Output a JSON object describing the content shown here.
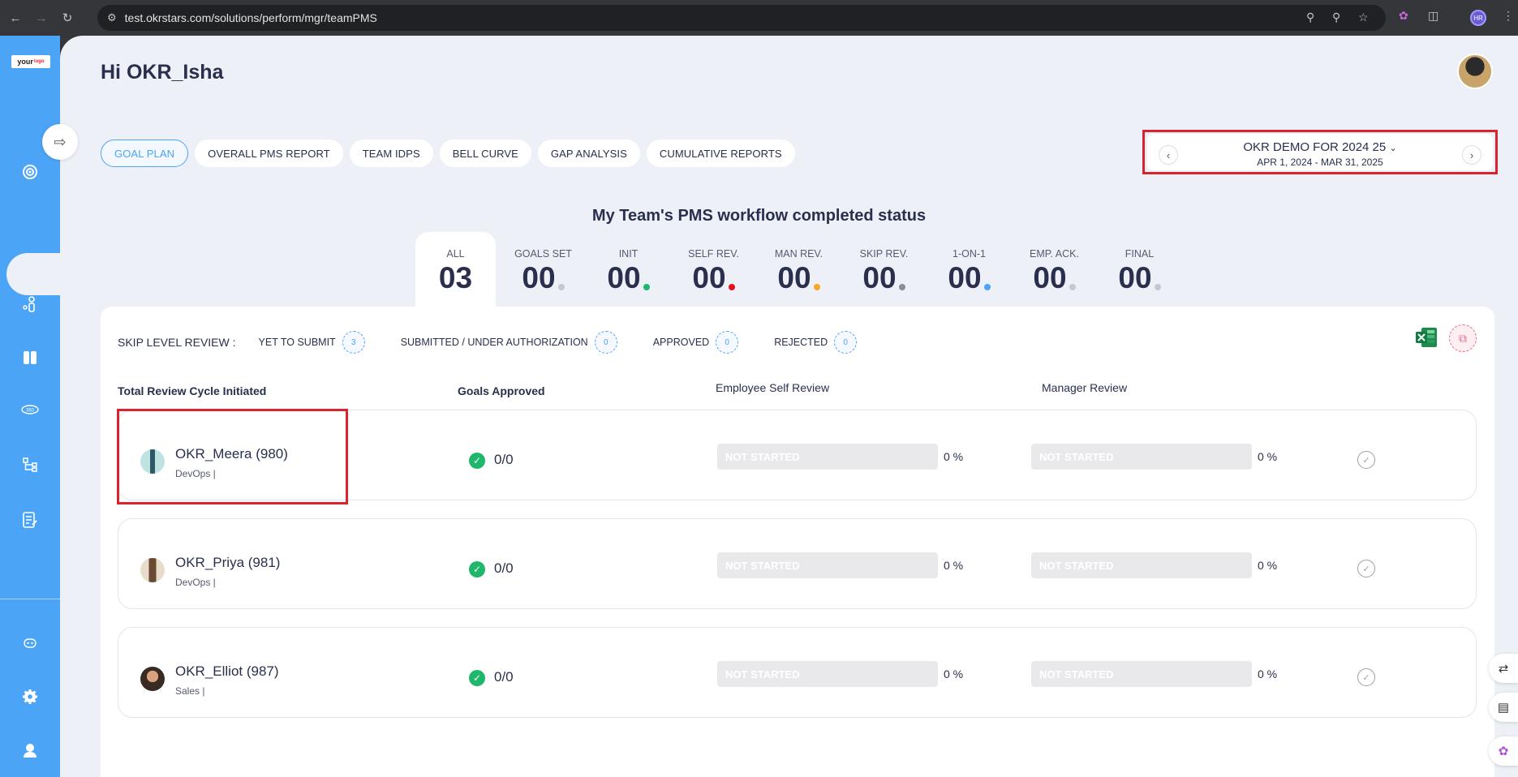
{
  "browser": {
    "url": "test.okrstars.com/solutions/perform/mgr/teamPMS",
    "profile_initials": "HR"
  },
  "brand": {
    "logo_text": "your",
    "logo_sup": "logo"
  },
  "greeting": "Hi OKR_Isha",
  "tabs": [
    {
      "label": "GOAL PLAN",
      "active": true
    },
    {
      "label": "OVERALL PMS REPORT"
    },
    {
      "label": "TEAM IDPS"
    },
    {
      "label": "BELL CURVE"
    },
    {
      "label": "GAP ANALYSIS"
    },
    {
      "label": "CUMULATIVE REPORTS"
    }
  ],
  "cycle": {
    "title": "OKR DEMO FOR 2024 25",
    "dates": "APR 1, 2024 - MAR 31, 2025"
  },
  "status_heading": "My Team's PMS workflow completed status",
  "stats": [
    {
      "label": "ALL",
      "value": "03",
      "dot": ""
    },
    {
      "label": "GOALS SET",
      "value": "00",
      "dot": "#c6c8cf"
    },
    {
      "label": "INIT",
      "value": "00",
      "dot": "#1fb76b"
    },
    {
      "label": "SELF REV.",
      "value": "00",
      "dot": "#e3141e"
    },
    {
      "label": "MAN REV.",
      "value": "00",
      "dot": "#f5a623"
    },
    {
      "label": "SKIP REV.",
      "value": "00",
      "dot": "#8a8d96"
    },
    {
      "label": "1-ON-1",
      "value": "00",
      "dot": "#4ba4f6"
    },
    {
      "label": "EMP. ACK.",
      "value": "00",
      "dot": "#c6c8cf"
    },
    {
      "label": "FINAL",
      "value": "00",
      "dot": "#c6c8cf"
    }
  ],
  "skip_review": {
    "title": "SKIP LEVEL REVIEW :",
    "items": [
      {
        "label": "YET TO SUBMIT",
        "count": "3"
      },
      {
        "label": "SUBMITTED / UNDER AUTHORIZATION",
        "count": "0"
      },
      {
        "label": "APPROVED",
        "count": "0"
      },
      {
        "label": "REJECTED",
        "count": "0"
      }
    ]
  },
  "columns": {
    "review_cycle": "Total Review Cycle Initiated",
    "goals": "Goals Approved",
    "self_review": "Employee Self Review",
    "manager_review": "Manager Review"
  },
  "employees": [
    {
      "name": "OKR_Meera (980)",
      "dept": "DevOps |",
      "goals": "0/0",
      "self_status": "NOT STARTED",
      "self_pct": "0 %",
      "mgr_status": "NOT STARTED",
      "mgr_pct": "0 %"
    },
    {
      "name": "OKR_Priya (981)",
      "dept": "DevOps |",
      "goals": "0/0",
      "self_status": "NOT STARTED",
      "self_pct": "0 %",
      "mgr_status": "NOT STARTED",
      "mgr_pct": "0 %"
    },
    {
      "name": "OKR_Elliot (987)",
      "dept": "Sales |",
      "goals": "0/0",
      "self_status": "NOT STARTED",
      "self_pct": "0 %",
      "mgr_status": "NOT STARTED",
      "mgr_pct": "0 %"
    }
  ],
  "colors": {
    "accent": "#4ba4f6",
    "text": "#292f4c",
    "highlight": "#d9232e",
    "success": "#1fb76b"
  }
}
